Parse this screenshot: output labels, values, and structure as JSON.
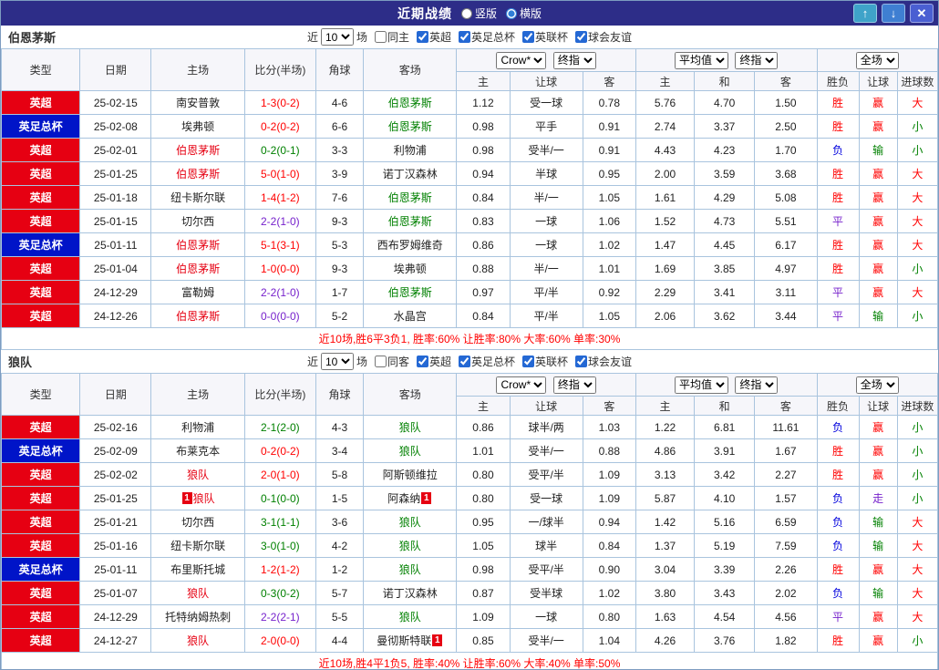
{
  "header": {
    "title": "近期战绩",
    "layout_options": [
      {
        "label": "竖版",
        "selected": false
      },
      {
        "label": "横版",
        "selected": true
      }
    ],
    "buttons": {
      "up": "↑",
      "down": "↓",
      "close": "✕"
    }
  },
  "filters": {
    "near_label": "近",
    "rounds_value": "10",
    "games_label": "场",
    "same_venue_checked": false,
    "leagues": [
      "英超",
      "英足总杯",
      "英联杯",
      "球会友谊"
    ],
    "leagues_checked": [
      true,
      true,
      true,
      true
    ]
  },
  "table_head": {
    "base_cols": [
      "类型",
      "日期",
      "主场",
      "比分(半场)",
      "角球",
      "客场"
    ],
    "asia": {
      "bookmaker": "Crow*",
      "stage": "终指",
      "cols": [
        "主",
        "让球",
        "客"
      ]
    },
    "euro": {
      "avg": "平均值",
      "stage": "终指",
      "cols": [
        "主",
        "和",
        "客"
      ]
    },
    "full": {
      "scope": "全场",
      "cols": [
        "胜负",
        "让球",
        "进球数"
      ]
    }
  },
  "colors": {
    "titlebar": "#2d2d88",
    "grid": "#a9c4de",
    "summary": "#ff0000",
    "red": "#ff0000",
    "green": "#008000",
    "blue": "#0000dd",
    "purple": "#7722cc",
    "black": "#222222",
    "epl": "#e60012",
    "facup": "#0014c8",
    "home_team": "#e60012",
    "away_team": "#008000",
    "btn_up": "#3fa3c9",
    "btn_down": "#3f7fd2",
    "btn_close": "#4a5fd2"
  },
  "sections": [
    {
      "team": "伯恩茅斯",
      "same_label": "同主",
      "summary": "近10场,胜6平3负1, 胜率:60% 让胜率:80% 大率:60% 单率:30%",
      "rows": [
        {
          "league": "英超",
          "league_color": "epl",
          "date": "25-02-15",
          "home": {
            "name": "南安普敦",
            "color": "black"
          },
          "score": "1-3(0-2)",
          "score_color": "red",
          "corner": "4-6",
          "away": {
            "name": "伯恩茅斯",
            "color": "away_team"
          },
          "asia": [
            "1.12",
            "受一球",
            "0.78"
          ],
          "euro": [
            "5.76",
            "4.70",
            "1.50"
          ],
          "results": [
            [
              "胜",
              "red"
            ],
            [
              "赢",
              "red"
            ],
            [
              "大",
              "red"
            ]
          ]
        },
        {
          "league": "英足总杯",
          "league_color": "facup",
          "date": "25-02-08",
          "home": {
            "name": "埃弗顿",
            "color": "black"
          },
          "score": "0-2(0-2)",
          "score_color": "red",
          "corner": "6-6",
          "away": {
            "name": "伯恩茅斯",
            "color": "away_team"
          },
          "asia": [
            "0.98",
            "平手",
            "0.91"
          ],
          "euro": [
            "2.74",
            "3.37",
            "2.50"
          ],
          "results": [
            [
              "胜",
              "red"
            ],
            [
              "赢",
              "red"
            ],
            [
              "小",
              "green"
            ]
          ]
        },
        {
          "league": "英超",
          "league_color": "epl",
          "date": "25-02-01",
          "home": {
            "name": "伯恩茅斯",
            "color": "home_team"
          },
          "score": "0-2(0-1)",
          "score_color": "green",
          "corner": "3-3",
          "away": {
            "name": "利物浦",
            "color": "black"
          },
          "asia": [
            "0.98",
            "受半/一",
            "0.91"
          ],
          "euro": [
            "4.43",
            "4.23",
            "1.70"
          ],
          "results": [
            [
              "负",
              "blue"
            ],
            [
              "输",
              "green"
            ],
            [
              "小",
              "green"
            ]
          ]
        },
        {
          "league": "英超",
          "league_color": "epl",
          "date": "25-01-25",
          "home": {
            "name": "伯恩茅斯",
            "color": "home_team"
          },
          "score": "5-0(1-0)",
          "score_color": "red",
          "corner": "3-9",
          "away": {
            "name": "诺丁汉森林",
            "color": "black"
          },
          "asia": [
            "0.94",
            "半球",
            "0.95"
          ],
          "euro": [
            "2.00",
            "3.59",
            "3.68"
          ],
          "results": [
            [
              "胜",
              "red"
            ],
            [
              "赢",
              "red"
            ],
            [
              "大",
              "red"
            ]
          ]
        },
        {
          "league": "英超",
          "league_color": "epl",
          "date": "25-01-18",
          "home": {
            "name": "纽卡斯尔联",
            "color": "black"
          },
          "score": "1-4(1-2)",
          "score_color": "red",
          "corner": "7-6",
          "away": {
            "name": "伯恩茅斯",
            "color": "away_team"
          },
          "asia": [
            "0.84",
            "半/一",
            "1.05"
          ],
          "euro": [
            "1.61",
            "4.29",
            "5.08"
          ],
          "results": [
            [
              "胜",
              "red"
            ],
            [
              "赢",
              "red"
            ],
            [
              "大",
              "red"
            ]
          ]
        },
        {
          "league": "英超",
          "league_color": "epl",
          "date": "25-01-15",
          "home": {
            "name": "切尔西",
            "color": "black"
          },
          "score": "2-2(1-0)",
          "score_color": "purple",
          "corner": "9-3",
          "away": {
            "name": "伯恩茅斯",
            "color": "away_team"
          },
          "asia": [
            "0.83",
            "一球",
            "1.06"
          ],
          "euro": [
            "1.52",
            "4.73",
            "5.51"
          ],
          "results": [
            [
              "平",
              "purple"
            ],
            [
              "赢",
              "red"
            ],
            [
              "大",
              "red"
            ]
          ]
        },
        {
          "league": "英足总杯",
          "league_color": "facup",
          "date": "25-01-11",
          "home": {
            "name": "伯恩茅斯",
            "color": "home_team"
          },
          "score": "5-1(3-1)",
          "score_color": "red",
          "corner": "5-3",
          "away": {
            "name": "西布罗姆维奇",
            "color": "black"
          },
          "asia": [
            "0.86",
            "一球",
            "1.02"
          ],
          "euro": [
            "1.47",
            "4.45",
            "6.17"
          ],
          "results": [
            [
              "胜",
              "red"
            ],
            [
              "赢",
              "red"
            ],
            [
              "大",
              "red"
            ]
          ]
        },
        {
          "league": "英超",
          "league_color": "epl",
          "date": "25-01-04",
          "home": {
            "name": "伯恩茅斯",
            "color": "home_team"
          },
          "score": "1-0(0-0)",
          "score_color": "red",
          "corner": "9-3",
          "away": {
            "name": "埃弗顿",
            "color": "black"
          },
          "asia": [
            "0.88",
            "半/一",
            "1.01"
          ],
          "euro": [
            "1.69",
            "3.85",
            "4.97"
          ],
          "results": [
            [
              "胜",
              "red"
            ],
            [
              "赢",
              "red"
            ],
            [
              "小",
              "green"
            ]
          ]
        },
        {
          "league": "英超",
          "league_color": "epl",
          "date": "24-12-29",
          "home": {
            "name": "富勒姆",
            "color": "black"
          },
          "score": "2-2(1-0)",
          "score_color": "purple",
          "corner": "1-7",
          "away": {
            "name": "伯恩茅斯",
            "color": "away_team"
          },
          "asia": [
            "0.97",
            "平/半",
            "0.92"
          ],
          "euro": [
            "2.29",
            "3.41",
            "3.11"
          ],
          "results": [
            [
              "平",
              "purple"
            ],
            [
              "赢",
              "red"
            ],
            [
              "大",
              "red"
            ]
          ]
        },
        {
          "league": "英超",
          "league_color": "epl",
          "date": "24-12-26",
          "home": {
            "name": "伯恩茅斯",
            "color": "home_team"
          },
          "score": "0-0(0-0)",
          "score_color": "purple",
          "corner": "5-2",
          "away": {
            "name": "水晶宫",
            "color": "black"
          },
          "asia": [
            "0.84",
            "平/半",
            "1.05"
          ],
          "euro": [
            "2.06",
            "3.62",
            "3.44"
          ],
          "results": [
            [
              "平",
              "purple"
            ],
            [
              "输",
              "green"
            ],
            [
              "小",
              "green"
            ]
          ]
        }
      ]
    },
    {
      "team": "狼队",
      "same_label": "同客",
      "summary": "近10场,胜4平1负5, 胜率:40% 让胜率:60% 大率:40% 单率:50%",
      "rows": [
        {
          "league": "英超",
          "league_color": "epl",
          "date": "25-02-16",
          "home": {
            "name": "利物浦",
            "color": "black"
          },
          "score": "2-1(2-0)",
          "score_color": "green",
          "corner": "4-3",
          "away": {
            "name": "狼队",
            "color": "away_team"
          },
          "asia": [
            "0.86",
            "球半/两",
            "1.03"
          ],
          "euro": [
            "1.22",
            "6.81",
            "11.61"
          ],
          "results": [
            [
              "负",
              "blue"
            ],
            [
              "赢",
              "red"
            ],
            [
              "小",
              "green"
            ]
          ]
        },
        {
          "league": "英足总杯",
          "league_color": "facup",
          "date": "25-02-09",
          "home": {
            "name": "布莱克本",
            "color": "black"
          },
          "score": "0-2(0-2)",
          "score_color": "red",
          "corner": "3-4",
          "away": {
            "name": "狼队",
            "color": "away_team"
          },
          "asia": [
            "1.01",
            "受半/一",
            "0.88"
          ],
          "euro": [
            "4.86",
            "3.91",
            "1.67"
          ],
          "results": [
            [
              "胜",
              "red"
            ],
            [
              "赢",
              "red"
            ],
            [
              "小",
              "green"
            ]
          ]
        },
        {
          "league": "英超",
          "league_color": "epl",
          "date": "25-02-02",
          "home": {
            "name": "狼队",
            "color": "home_team"
          },
          "score": "2-0(1-0)",
          "score_color": "red",
          "corner": "5-8",
          "away": {
            "name": "阿斯顿维拉",
            "color": "black"
          },
          "asia": [
            "0.80",
            "受平/半",
            "1.09"
          ],
          "euro": [
            "3.13",
            "3.42",
            "2.27"
          ],
          "results": [
            [
              "胜",
              "red"
            ],
            [
              "赢",
              "red"
            ],
            [
              "小",
              "green"
            ]
          ]
        },
        {
          "league": "英超",
          "league_color": "epl",
          "date": "25-01-25",
          "home": {
            "name": "狼队",
            "color": "home_team",
            "card_before": "1"
          },
          "score": "0-1(0-0)",
          "score_color": "green",
          "corner": "1-5",
          "away": {
            "name": "阿森纳",
            "color": "black",
            "card_after": "1"
          },
          "asia": [
            "0.80",
            "受一球",
            "1.09"
          ],
          "euro": [
            "5.87",
            "4.10",
            "1.57"
          ],
          "results": [
            [
              "负",
              "blue"
            ],
            [
              "走",
              "purple"
            ],
            [
              "小",
              "green"
            ]
          ]
        },
        {
          "league": "英超",
          "league_color": "epl",
          "date": "25-01-21",
          "home": {
            "name": "切尔西",
            "color": "black"
          },
          "score": "3-1(1-1)",
          "score_color": "green",
          "corner": "3-6",
          "away": {
            "name": "狼队",
            "color": "away_team"
          },
          "asia": [
            "0.95",
            "一/球半",
            "0.94"
          ],
          "euro": [
            "1.42",
            "5.16",
            "6.59"
          ],
          "results": [
            [
              "负",
              "blue"
            ],
            [
              "输",
              "green"
            ],
            [
              "大",
              "red"
            ]
          ]
        },
        {
          "league": "英超",
          "league_color": "epl",
          "date": "25-01-16",
          "home": {
            "name": "纽卡斯尔联",
            "color": "black"
          },
          "score": "3-0(1-0)",
          "score_color": "green",
          "corner": "4-2",
          "away": {
            "name": "狼队",
            "color": "away_team"
          },
          "asia": [
            "1.05",
            "球半",
            "0.84"
          ],
          "euro": [
            "1.37",
            "5.19",
            "7.59"
          ],
          "results": [
            [
              "负",
              "blue"
            ],
            [
              "输",
              "green"
            ],
            [
              "大",
              "red"
            ]
          ]
        },
        {
          "league": "英足总杯",
          "league_color": "facup",
          "date": "25-01-11",
          "home": {
            "name": "布里斯托城",
            "color": "black"
          },
          "score": "1-2(1-2)",
          "score_color": "red",
          "corner": "1-2",
          "away": {
            "name": "狼队",
            "color": "away_team"
          },
          "asia": [
            "0.98",
            "受平/半",
            "0.90"
          ],
          "euro": [
            "3.04",
            "3.39",
            "2.26"
          ],
          "results": [
            [
              "胜",
              "red"
            ],
            [
              "赢",
              "red"
            ],
            [
              "大",
              "red"
            ]
          ]
        },
        {
          "league": "英超",
          "league_color": "epl",
          "date": "25-01-07",
          "home": {
            "name": "狼队",
            "color": "home_team"
          },
          "score": "0-3(0-2)",
          "score_color": "green",
          "corner": "5-7",
          "away": {
            "name": "诺丁汉森林",
            "color": "black"
          },
          "asia": [
            "0.87",
            "受半球",
            "1.02"
          ],
          "euro": [
            "3.80",
            "3.43",
            "2.02"
          ],
          "results": [
            [
              "负",
              "blue"
            ],
            [
              "输",
              "green"
            ],
            [
              "大",
              "red"
            ]
          ]
        },
        {
          "league": "英超",
          "league_color": "epl",
          "date": "24-12-29",
          "home": {
            "name": "托特纳姆热刺",
            "color": "black"
          },
          "score": "2-2(2-1)",
          "score_color": "purple",
          "corner": "5-5",
          "away": {
            "name": "狼队",
            "color": "away_team"
          },
          "asia": [
            "1.09",
            "一球",
            "0.80"
          ],
          "euro": [
            "1.63",
            "4.54",
            "4.56"
          ],
          "results": [
            [
              "平",
              "purple"
            ],
            [
              "赢",
              "red"
            ],
            [
              "大",
              "red"
            ]
          ]
        },
        {
          "league": "英超",
          "league_color": "epl",
          "date": "24-12-27",
          "home": {
            "name": "狼队",
            "color": "home_team"
          },
          "score": "2-0(0-0)",
          "score_color": "red",
          "corner": "4-4",
          "away": {
            "name": "曼彻斯特联",
            "color": "black",
            "card_after": "1"
          },
          "asia": [
            "0.85",
            "受半/一",
            "1.04"
          ],
          "euro": [
            "4.26",
            "3.76",
            "1.82"
          ],
          "results": [
            [
              "胜",
              "red"
            ],
            [
              "赢",
              "red"
            ],
            [
              "小",
              "green"
            ]
          ]
        }
      ]
    }
  ]
}
